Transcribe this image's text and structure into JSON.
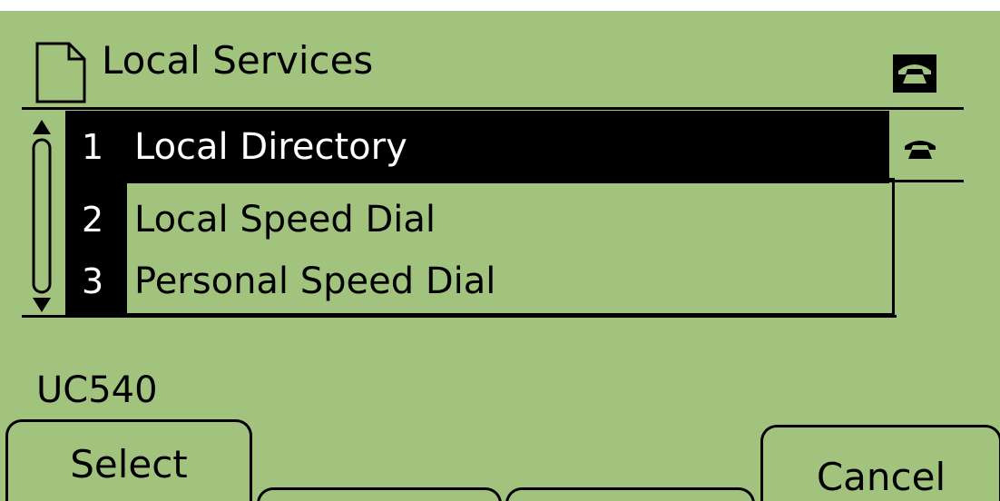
{
  "header": {
    "title": "Local Services",
    "icon": "document-icon"
  },
  "lines": {
    "line1_icon": "phone-handset-icon",
    "line2_icon": "phone-handset-icon"
  },
  "menu": {
    "items": [
      {
        "number": "1",
        "label": "Local Directory",
        "selected": true
      },
      {
        "number": "2",
        "label": "Local Speed Dial",
        "selected": false
      },
      {
        "number": "3",
        "label": "Personal Speed Dial",
        "selected": false
      }
    ]
  },
  "status": {
    "text": "UC540"
  },
  "softkeys": {
    "select": "Select",
    "key2": "",
    "key3": "",
    "cancel": "Cancel"
  },
  "colors": {
    "lcd_background": "#a2c37d",
    "foreground": "#000000",
    "highlight_text": "#ffffff"
  }
}
